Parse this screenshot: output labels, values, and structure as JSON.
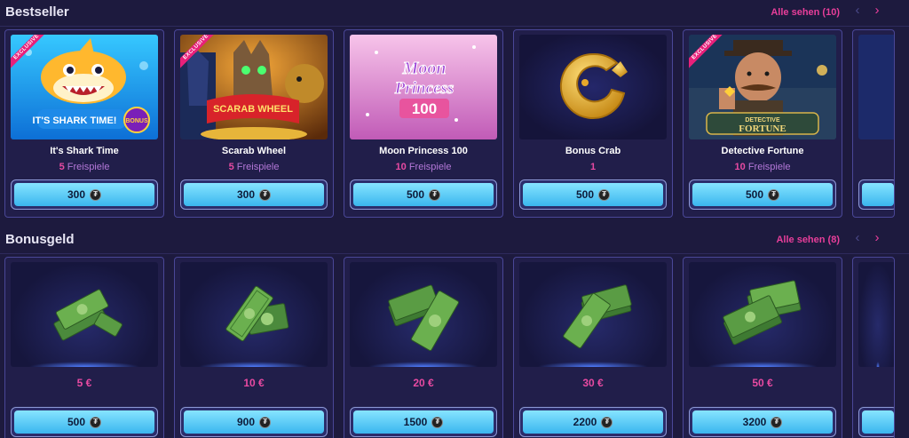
{
  "bestseller": {
    "title": "Bestseller",
    "see_all": "Alle sehen (10)",
    "cards": [
      {
        "name": "It's Shark Time",
        "count": "5",
        "unit": "Freispiele",
        "price": "300",
        "badge": "EXCLUSIVE"
      },
      {
        "name": "Scarab Wheel",
        "count": "5",
        "unit": "Freispiele",
        "price": "300",
        "badge": "EXCLUSIVE"
      },
      {
        "name": "Moon Princess 100",
        "count": "10",
        "unit": "Freispiele",
        "price": "500"
      },
      {
        "name": "Bonus Crab",
        "count": "1",
        "unit": "",
        "price": "500"
      },
      {
        "name": "Detective Fortune",
        "count": "10",
        "unit": "Freispiele",
        "price": "500",
        "badge": "EXCLUSIVE"
      }
    ],
    "art_text": {
      "shark": "IT'S SHARK TIME!",
      "shark_bonus": "BONUS",
      "scarab": "SCARAB WHEEL",
      "moon1": "Moon",
      "moon2": "Princess",
      "moon3": "100",
      "detective1": "DETECTIVE",
      "detective2": "FORTUNE"
    }
  },
  "bonusgeld": {
    "title": "Bonusgeld",
    "see_all": "Alle sehen (8)",
    "cards": [
      {
        "amount": "5 €",
        "price": "500"
      },
      {
        "amount": "10 €",
        "price": "900"
      },
      {
        "amount": "20 €",
        "price": "1500"
      },
      {
        "amount": "30 €",
        "price": "2200"
      },
      {
        "amount": "50 €",
        "price": "3200"
      }
    ]
  },
  "icons": {
    "prev": "‹",
    "next": "›",
    "coin": "₮"
  },
  "colors": {
    "background": "#1d1a3e",
    "card": "#211e4a",
    "accent_pink": "#e83e9a",
    "button": "#3ab6ee"
  }
}
